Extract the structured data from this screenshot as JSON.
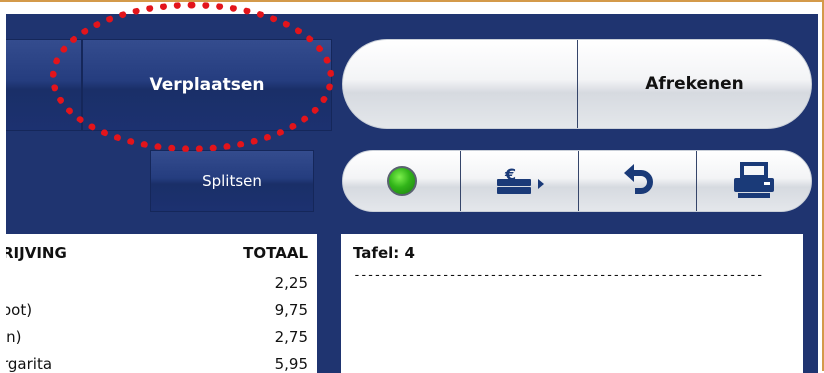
{
  "theme": {
    "panel_bg": "#1f3470",
    "highlight_color": "#e3141b",
    "status_color": "#31b419",
    "accent_border": "#d49a4a"
  },
  "buttons": {
    "move_label": "Verplaatsen",
    "split_label": "Splitsen",
    "checkout_label": "Afrekenen"
  },
  "toolbar": {
    "icons": [
      "status-online-icon",
      "cash-drawer-icon",
      "undo-icon",
      "printer-icon"
    ]
  },
  "order_table": {
    "headers": {
      "description": "RIJVING",
      "total": "TOTAAL"
    },
    "rows": [
      {
        "description": "",
        "total": "2,25"
      },
      {
        "description": "oot)",
        "total": "9,75"
      },
      {
        "description": "in)",
        "total": "2,75"
      },
      {
        "description": "rgarita",
        "total": "5,95"
      }
    ]
  },
  "receipt": {
    "title": "Tafel: 4",
    "divider": "------------------------------------------------------------"
  }
}
